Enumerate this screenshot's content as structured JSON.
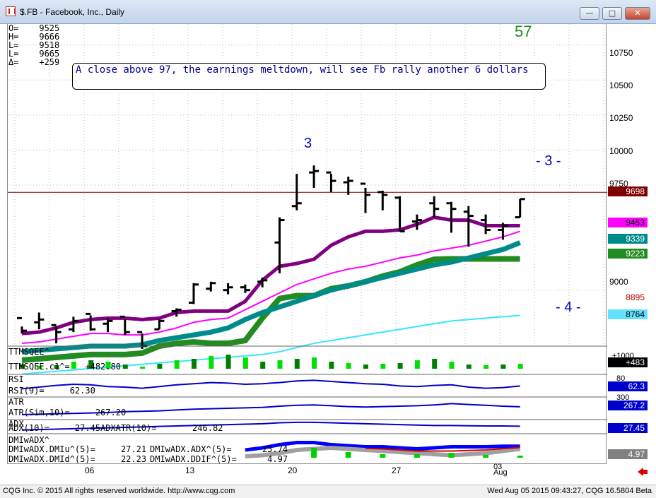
{
  "window": {
    "title": "$.FB - Facebook, Inc., Daily"
  },
  "ohlc": {
    "o": "O=    9525",
    "h": "H=    9666",
    "l": "L=    9518",
    "last": "L=    9665",
    "delta": "Δ=    +259"
  },
  "annotation": {
    "text": "A close above 97, the earnings meltdown, will see Fb rally another 6 dollars"
  },
  "chart_labels": {
    "count57": "57",
    "three_top": "3",
    "three_right": "- 3 -",
    "four": "- 4 -"
  },
  "y_axis": [
    "10750",
    "10500",
    "10250",
    "10000",
    "9750",
    "9000"
  ],
  "price_tags": [
    {
      "value": "9698",
      "bg": "#800000",
      "fg": "#ffffff"
    },
    {
      "value": "9453",
      "bg": "#ff00ff",
      "fg": "#000000"
    },
    {
      "value": "9339",
      "bg": "#008b8b",
      "fg": "#ffffff"
    },
    {
      "value": "9223",
      "bg": "#228b22",
      "fg": "#ffffff"
    },
    {
      "value": "8895",
      "bg": "#ffffff",
      "fg": "#c00000"
    },
    {
      "value": "8764",
      "bg": "#66e0ff",
      "fg": "#000000"
    }
  ],
  "ttm": {
    "name": "TTMSQEE^",
    "value_label": "TTMSQEE.c1^=   +482.80",
    "tag": "+483",
    "axis": "+1000"
  },
  "rsi": {
    "name": "RSI",
    "value_label": "RSI(9)=     62.30",
    "tag": "62.3",
    "axis": "80"
  },
  "atr": {
    "name": "ATR",
    "value_label": "ATR(Sim,10)=     267.20",
    "tag": "267.2",
    "axis": "300"
  },
  "adx": {
    "name": "ADX",
    "value_label": "ADX(10)=     27.45",
    "value_label2": "ADXATR(10)=       246.82",
    "tag": "27.45"
  },
  "dmi": {
    "name": "DMIwADX^",
    "l1": "DMIwADX.DMIu^(5)=     27.21",
    "l2": "DMIwADX.DMId^(5)=     22.23",
    "l3": "DMIwADX.ADX^(5)=      25.74",
    "l4": "DMIwADX.DDIF^(5)=      4.97",
    "tag": "4.97"
  },
  "x_axis": [
    "06",
    "13",
    "20",
    "27",
    "03"
  ],
  "x_month": "Aug",
  "status": {
    "left": "CQG Inc. © 2015 All rights reserved worldwide. http://www.cqg.com",
    "right": "Wed Aug 05 2015 09:43:27, CQG 16.5804 Beta"
  },
  "chart_data": {
    "type": "ohlc",
    "ylim": [
      8600,
      10900
    ],
    "bars": [
      [
        8800,
        8740,
        8690,
        8710
      ],
      [
        8770,
        8840,
        8720,
        8790
      ],
      [
        8750,
        8740,
        8620,
        8700
      ],
      [
        8720,
        8810,
        8700,
        8780
      ],
      [
        8830,
        8820,
        8710,
        8720
      ],
      [
        8760,
        8800,
        8700,
        8780
      ],
      [
        8810,
        8790,
        8680,
        8700
      ],
      [
        8700,
        8690,
        8580,
        8600
      ],
      [
        8720,
        8790,
        8720,
        8780
      ],
      [
        8850,
        8870,
        8810,
        8860
      ],
      [
        8910,
        9050,
        8900,
        9040
      ],
      [
        9010,
        9060,
        8990,
        9050
      ],
      [
        9000,
        9050,
        8970,
        9020
      ],
      [
        9020,
        9040,
        8980,
        9000
      ],
      [
        9060,
        9090,
        9020,
        9070
      ],
      [
        9340,
        9520,
        9120,
        9500
      ],
      [
        9600,
        9830,
        9570,
        9620
      ],
      [
        9840,
        9890,
        9730,
        9850
      ],
      [
        9840,
        9830,
        9700,
        9780
      ],
      [
        9770,
        9810,
        9680,
        9780
      ],
      [
        9760,
        9730,
        9550,
        9680
      ],
      [
        9700,
        9710,
        9570,
        9680
      ],
      [
        9660,
        9670,
        9420,
        9420
      ],
      [
        9490,
        9540,
        9430,
        9500
      ],
      [
        9620,
        9670,
        9520,
        9580
      ],
      [
        9620,
        9630,
        9410,
        9580
      ],
      [
        9560,
        9600,
        9310,
        9530
      ],
      [
        9500,
        9540,
        9400,
        9430
      ],
      [
        9430,
        9480,
        9360,
        9460
      ],
      [
        9520,
        9650,
        9520,
        9650
      ]
    ],
    "ma": [
      {
        "name": "purple",
        "color": "#800080",
        "values": [
          8690,
          8700,
          8730,
          8770,
          8790,
          8800,
          8800,
          8790,
          8800,
          8840,
          8850,
          8850,
          8850,
          8920,
          9070,
          9170,
          9190,
          9220,
          9320,
          9380,
          9420,
          9420,
          9430,
          9470,
          9520,
          9500,
          9500,
          9460,
          9460,
          9460
        ]
      },
      {
        "name": "magenta",
        "color": "#ff00ff",
        "values": [
          8620,
          8630,
          8650,
          8670,
          8690,
          8690,
          8680,
          8680,
          8700,
          8730,
          8770,
          8790,
          8800,
          8860,
          8920,
          8980,
          9040,
          9080,
          9120,
          9150,
          9170,
          9200,
          9230,
          9250,
          9280,
          9300,
          9320,
          9350,
          9380,
          9420
        ]
      },
      {
        "name": "teal",
        "color": "#008b8b",
        "values": [
          8560,
          8570,
          8580,
          8590,
          8600,
          8600,
          8600,
          8610,
          8640,
          8660,
          8680,
          8700,
          8730,
          8790,
          8840,
          8880,
          8920,
          8960,
          9000,
          9030,
          9060,
          9090,
          9120,
          9150,
          9180,
          9200,
          9230,
          9260,
          9290,
          9339
        ]
      },
      {
        "name": "green",
        "color": "#228b22",
        "values": [
          8500,
          8510,
          8520,
          8530,
          8540,
          8540,
          8540,
          8550,
          8600,
          8620,
          8630,
          8620,
          8620,
          8640,
          8800,
          8940,
          8960,
          8960,
          9010,
          9030,
          9060,
          9100,
          9130,
          9180,
          9220,
          9223,
          9223,
          9223,
          9223,
          9223
        ]
      },
      {
        "name": "cyan",
        "color": "#33e6ff",
        "values": [
          8400,
          8410,
          8420,
          8430,
          8440,
          8450,
          8460,
          8470,
          8480,
          8490,
          8500,
          8510,
          8520,
          8530,
          8540,
          8560,
          8590,
          8620,
          8640,
          8660,
          8680,
          8700,
          8720,
          8740,
          8760,
          8780,
          8790,
          8800,
          8810,
          8820
        ]
      }
    ]
  }
}
